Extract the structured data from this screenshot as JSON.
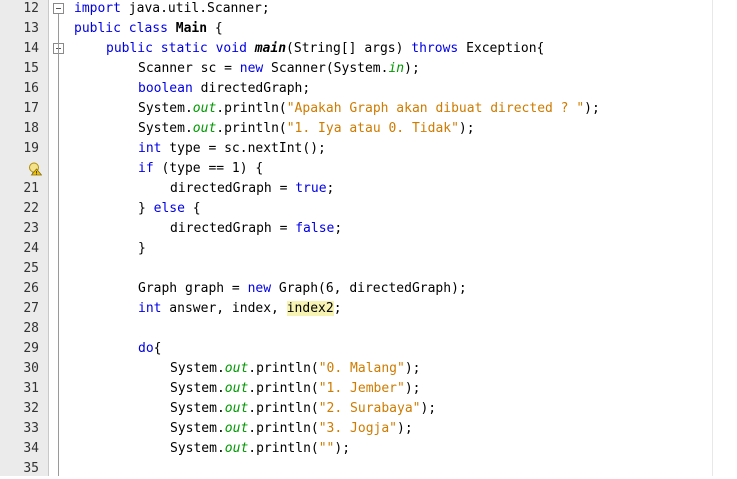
{
  "editor": {
    "lines": [
      {
        "n": "12",
        "indent": 0,
        "fold": true,
        "hint": false,
        "tokens": [
          [
            "import",
            "kw"
          ],
          [
            " java.util.Scanner;",
            ""
          ]
        ]
      },
      {
        "n": "13",
        "indent": 0,
        "fold": false,
        "hint": false,
        "tokens": [
          [
            "public",
            "kw"
          ],
          [
            " ",
            ""
          ],
          [
            "class",
            "kw"
          ],
          [
            " ",
            ""
          ],
          [
            "Main",
            "cls"
          ],
          [
            " {",
            ""
          ]
        ]
      },
      {
        "n": "14",
        "indent": 1,
        "fold": true,
        "hint": false,
        "tokens": [
          [
            "public",
            "kw"
          ],
          [
            " ",
            ""
          ],
          [
            "static",
            "kw"
          ],
          [
            " ",
            ""
          ],
          [
            "void",
            "kw"
          ],
          [
            " ",
            ""
          ],
          [
            "main",
            "meth"
          ],
          [
            "(String[] args) ",
            ""
          ],
          [
            "throws",
            "kw"
          ],
          [
            " Exception{",
            ""
          ]
        ]
      },
      {
        "n": "15",
        "indent": 2,
        "fold": false,
        "hint": false,
        "tokens": [
          [
            "Scanner sc = ",
            ""
          ],
          [
            "new",
            "kw"
          ],
          [
            " Scanner(System.",
            ""
          ],
          [
            "in",
            "fld"
          ],
          [
            ");",
            ""
          ]
        ]
      },
      {
        "n": "16",
        "indent": 2,
        "fold": false,
        "hint": false,
        "tokens": [
          [
            "boolean",
            "kw"
          ],
          [
            " directedGraph;",
            ""
          ]
        ]
      },
      {
        "n": "17",
        "indent": 2,
        "fold": false,
        "hint": false,
        "tokens": [
          [
            "System.",
            ""
          ],
          [
            "out",
            "fld"
          ],
          [
            ".println(",
            ""
          ],
          [
            "\"Apakah Graph akan dibuat directed ? \"",
            "str"
          ],
          [
            ");",
            ""
          ]
        ]
      },
      {
        "n": "18",
        "indent": 2,
        "fold": false,
        "hint": false,
        "tokens": [
          [
            "System.",
            ""
          ],
          [
            "out",
            "fld"
          ],
          [
            ".println(",
            ""
          ],
          [
            "\"1. Iya atau 0. Tidak\"",
            "str"
          ],
          [
            ");",
            ""
          ]
        ]
      },
      {
        "n": "19",
        "indent": 2,
        "fold": false,
        "hint": false,
        "tokens": [
          [
            "int",
            "kw"
          ],
          [
            " type = sc.nextInt();",
            ""
          ]
        ]
      },
      {
        "n": "",
        "indent": 2,
        "fold": false,
        "hint": true,
        "tokens": [
          [
            "if",
            "kw"
          ],
          [
            " (type == 1) {",
            ""
          ]
        ]
      },
      {
        "n": "21",
        "indent": 3,
        "fold": false,
        "hint": false,
        "tokens": [
          [
            "directedGraph = ",
            ""
          ],
          [
            "true",
            "kw"
          ],
          [
            ";",
            ""
          ]
        ]
      },
      {
        "n": "22",
        "indent": 2,
        "fold": false,
        "hint": false,
        "tokens": [
          [
            "} ",
            ""
          ],
          [
            "else",
            "kw"
          ],
          [
            " {",
            ""
          ]
        ]
      },
      {
        "n": "23",
        "indent": 3,
        "fold": false,
        "hint": false,
        "tokens": [
          [
            "directedGraph = ",
            ""
          ],
          [
            "false",
            "kw"
          ],
          [
            ";",
            ""
          ]
        ]
      },
      {
        "n": "24",
        "indent": 2,
        "fold": false,
        "hint": false,
        "tokens": [
          [
            "}",
            ""
          ]
        ]
      },
      {
        "n": "25",
        "indent": 0,
        "fold": false,
        "hint": false,
        "tokens": []
      },
      {
        "n": "26",
        "indent": 2,
        "fold": false,
        "hint": false,
        "tokens": [
          [
            "Graph graph = ",
            ""
          ],
          [
            "new",
            "kw"
          ],
          [
            " Graph(6, directedGraph);",
            ""
          ]
        ]
      },
      {
        "n": "27",
        "indent": 2,
        "fold": false,
        "hint": false,
        "tokens": [
          [
            "int",
            "kw"
          ],
          [
            " answer, index, ",
            ""
          ],
          [
            "index2",
            "hl"
          ],
          [
            ";",
            ""
          ]
        ]
      },
      {
        "n": "28",
        "indent": 0,
        "fold": false,
        "hint": false,
        "tokens": []
      },
      {
        "n": "29",
        "indent": 2,
        "fold": false,
        "hint": false,
        "tokens": [
          [
            "do",
            "kw"
          ],
          [
            "{",
            ""
          ]
        ]
      },
      {
        "n": "30",
        "indent": 3,
        "fold": false,
        "hint": false,
        "tokens": [
          [
            "System.",
            ""
          ],
          [
            "out",
            "fld"
          ],
          [
            ".println(",
            ""
          ],
          [
            "\"0. Malang\"",
            "str"
          ],
          [
            ");",
            ""
          ]
        ]
      },
      {
        "n": "31",
        "indent": 3,
        "fold": false,
        "hint": false,
        "tokens": [
          [
            "System.",
            ""
          ],
          [
            "out",
            "fld"
          ],
          [
            ".println(",
            ""
          ],
          [
            "\"1. Jember\"",
            "str"
          ],
          [
            ");",
            ""
          ]
        ]
      },
      {
        "n": "32",
        "indent": 3,
        "fold": false,
        "hint": false,
        "tokens": [
          [
            "System.",
            ""
          ],
          [
            "out",
            "fld"
          ],
          [
            ".println(",
            ""
          ],
          [
            "\"2. Surabaya\"",
            "str"
          ],
          [
            ");",
            ""
          ]
        ]
      },
      {
        "n": "33",
        "indent": 3,
        "fold": false,
        "hint": false,
        "tokens": [
          [
            "System.",
            ""
          ],
          [
            "out",
            "fld"
          ],
          [
            ".println(",
            ""
          ],
          [
            "\"3. Jogja\"",
            "str"
          ],
          [
            ");",
            ""
          ]
        ]
      },
      {
        "n": "34",
        "indent": 3,
        "fold": false,
        "hint": false,
        "tokens": [
          [
            "System.",
            ""
          ],
          [
            "out",
            "fld"
          ],
          [
            ".println(",
            ""
          ],
          [
            "\"\"",
            "str"
          ],
          [
            ");",
            ""
          ]
        ]
      },
      {
        "n": "35",
        "indent": 0,
        "fold": false,
        "hint": false,
        "tokens": []
      }
    ],
    "hint_icon": "lightbulb-warning-icon",
    "fold_icon": "fold-collapse-icon"
  }
}
